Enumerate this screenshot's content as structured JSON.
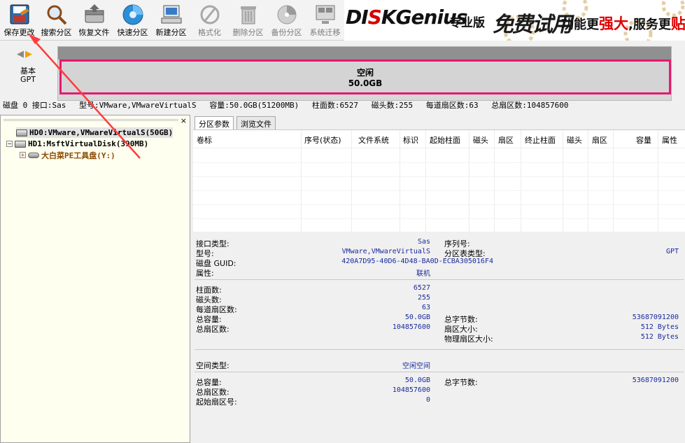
{
  "toolbar": {
    "items": [
      {
        "label": "保存更改",
        "icon": "save-disk-icon"
      },
      {
        "label": "搜索分区",
        "icon": "search-magnifier-icon"
      },
      {
        "label": "恢复文件",
        "icon": "recover-files-icon"
      },
      {
        "label": "快速分区",
        "icon": "quick-partition-icon"
      },
      {
        "label": "新建分区",
        "icon": "new-partition-icon"
      },
      {
        "label": "格式化",
        "icon": "format-icon"
      },
      {
        "label": "删除分区",
        "icon": "trash-icon"
      },
      {
        "label": "备份分区",
        "icon": "backup-icon"
      },
      {
        "label": "系统迁移",
        "icon": "system-migrate-icon"
      }
    ]
  },
  "banner": {
    "logo_pre": "DI",
    "logo_mid": "S",
    "logo_post": "KGenius",
    "edition": "专业版",
    "free": "免费试用",
    "slogan_a": "功能更",
    "slogan_hl1": "强大",
    "slogan_b": ",服务更",
    "slogan_hl2": "贴心"
  },
  "diskmap": {
    "style_line1": "基本",
    "style_line2": "GPT",
    "partition_name": "空闲",
    "partition_size": "50.0GB"
  },
  "infoline": {
    "disk": "磁盘 0 接口:Sas",
    "model": "型号:VMware,VMwareVirtualS",
    "capacity": "容量:50.0GB(51200MB)",
    "cylinders": "柱面数:6527",
    "heads": "磁头数:255",
    "sectors_per_track": "每道扇区数:63",
    "total_sectors": "总扇区数:104857600"
  },
  "tree": {
    "close": "×",
    "hd0": "HD0:VMware,VMwareVirtualS(50GB)",
    "hd1": "HD1:MsftVirtualDisk(390MB)",
    "hd1_part": "大白菜PE工具盘(Y:)"
  },
  "tabs": [
    "分区参数",
    "浏览文件"
  ],
  "table_headers": [
    "卷标",
    "序号(状态)",
    "文件系统",
    "标识",
    "起始柱面",
    "磁头",
    "扇区",
    "终止柱面",
    "磁头",
    "扇区",
    "容量",
    "属性"
  ],
  "details": {
    "interface_label": "接口类型:",
    "interface_value": "Sas",
    "serial_label": "序列号:",
    "model_label": "型号:",
    "model_value": "VMware,VMwareVirtualS",
    "ptable_label": "分区表类型:",
    "ptable_value": "GPT",
    "guid_label": "磁盘 GUID:",
    "guid_value": "420A7D95-40D6-4D48-BA0D-ECBA305016F4",
    "attr_label": "属性:",
    "attr_value": "联机",
    "cyl_label": "柱面数:",
    "cyl_value": "6527",
    "heads_label": "磁头数:",
    "heads_value": "255",
    "spt_label": "每道扇区数:",
    "spt_value": "63",
    "cap_label": "总容量:",
    "cap_value": "50.0GB",
    "bytes_label": "总字节数:",
    "bytes_value": "53687091200",
    "tsec_label": "总扇区数:",
    "tsec_value": "104857600",
    "secsize_label": "扇区大小:",
    "secsize_value": "512 Bytes",
    "physsec_label": "物理扇区大小:",
    "physsec_value": "512 Bytes",
    "space_type_label": "空间类型:",
    "space_type_value": "空闲空间",
    "free_cap_label": "总容量:",
    "free_cap_value": "50.0GB",
    "free_bytes_label": "总字节数:",
    "free_bytes_value": "53687091200",
    "free_tsec_label": "总扇区数:",
    "free_tsec_value": "104857600",
    "start_sec_label": "起始扇区号:",
    "start_sec_value": "0"
  }
}
